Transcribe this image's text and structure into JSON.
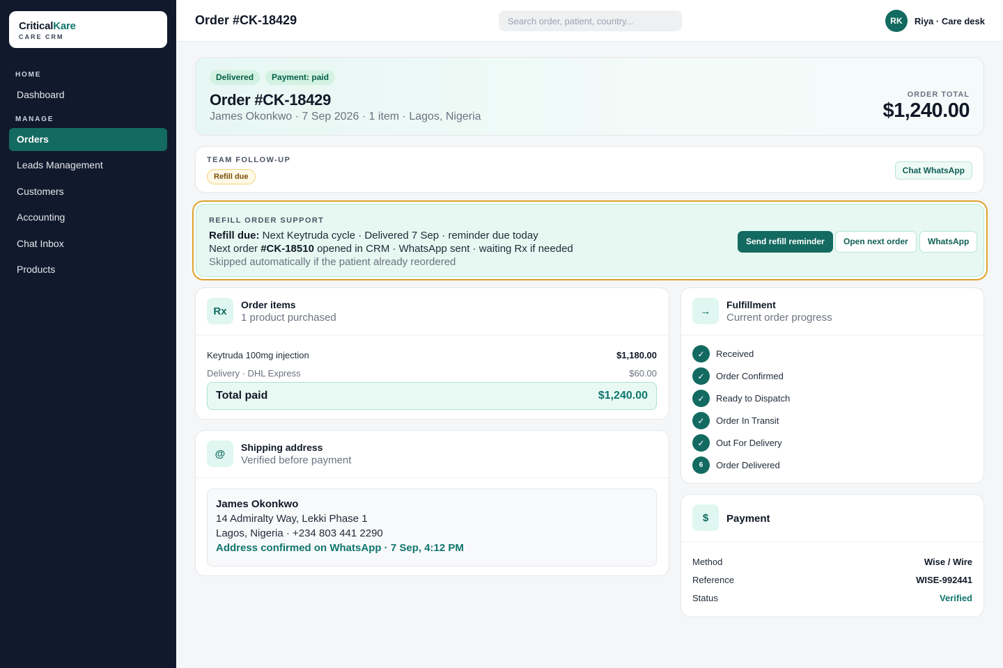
{
  "brand": {
    "name_main": "Critical",
    "name_accent": "Kare",
    "subtitle": "CARE CRM"
  },
  "sidebar": {
    "sections": {
      "home": "HOME",
      "manage": "MANAGE"
    },
    "items": [
      {
        "label": "Dashboard"
      },
      {
        "label": "Orders",
        "active": true
      },
      {
        "label": "Leads Management"
      },
      {
        "label": "Customers"
      },
      {
        "label": "Accounting"
      },
      {
        "label": "Chat Inbox"
      },
      {
        "label": "Products"
      }
    ]
  },
  "topbar": {
    "title": "Order #CK-18429",
    "search_placeholder": "Search order, patient, country...",
    "user": {
      "initials": "RK",
      "name": "Riya · Care desk"
    }
  },
  "hero": {
    "badges": [
      "Delivered",
      "Payment: paid"
    ],
    "title": "Order #CK-18429",
    "subtitle": "James Okonkwo · 7 Sep 2026 · 1 item · Lagos, Nigeria",
    "total_label": "ORDER TOTAL",
    "total_value": "$1,240.00"
  },
  "followup": {
    "label": "TEAM FOLLOW-UP",
    "tag": "Refill due",
    "button": "Chat WhatsApp"
  },
  "refill": {
    "label": "REFILL ORDER SUPPORT",
    "line1_bold": "Refill due:",
    "line1_rest": " Next Keytruda cycle · Delivered 7 Sep · reminder due today",
    "line2_pre": "Next order ",
    "line2_bold": "#CK-18510",
    "line2_rest": " opened in CRM · WhatsApp sent · waiting Rx if needed",
    "line3": "Skipped automatically if the patient already reordered",
    "buttons": {
      "primary": "Send refill reminder",
      "next_order": "Open next order",
      "whatsapp": "WhatsApp"
    }
  },
  "order_items": {
    "icon_label": "Rx",
    "title": "Order items",
    "subtitle": "1 product purchased",
    "rows": [
      {
        "name": "Keytruda 100mg injection",
        "amount": "$1,180.00"
      },
      {
        "name": "Delivery · DHL Express",
        "amount": "$60.00"
      }
    ],
    "total_label": "Total paid",
    "total_value": "$1,240.00"
  },
  "shipping": {
    "icon_label": "@",
    "title": "Shipping address",
    "subtitle": "Verified before payment",
    "name": "James Okonkwo",
    "line1": "14 Admiralty Way, Lekki Phase 1",
    "line2": "Lagos, Nigeria · +234 803 441 2290",
    "confirmation": "Address confirmed on WhatsApp · 7 Sep, 4:12 PM"
  },
  "fulfillment": {
    "icon_label": "→",
    "title": "Fulfillment",
    "subtitle": "Current order progress",
    "steps": [
      {
        "label": "Received",
        "marker": "✓"
      },
      {
        "label": "Order Confirmed",
        "marker": "✓"
      },
      {
        "label": "Ready to Dispatch",
        "marker": "✓"
      },
      {
        "label": "Order In Transit",
        "marker": "✓"
      },
      {
        "label": "Out For Delivery",
        "marker": "✓"
      },
      {
        "label": "Order Delivered",
        "marker": "6"
      }
    ]
  },
  "payment": {
    "icon_label": "$",
    "title": "Payment",
    "rows": [
      {
        "label": "Method",
        "value": "Wise / Wire"
      },
      {
        "label": "Reference",
        "value": "WISE-992441"
      },
      {
        "label": "Status",
        "value": "Verified"
      }
    ]
  },
  "colors": {
    "brand_green": "#136a60",
    "refill_border": "#e0a12a",
    "sidebar_bg": "#111a2d"
  }
}
